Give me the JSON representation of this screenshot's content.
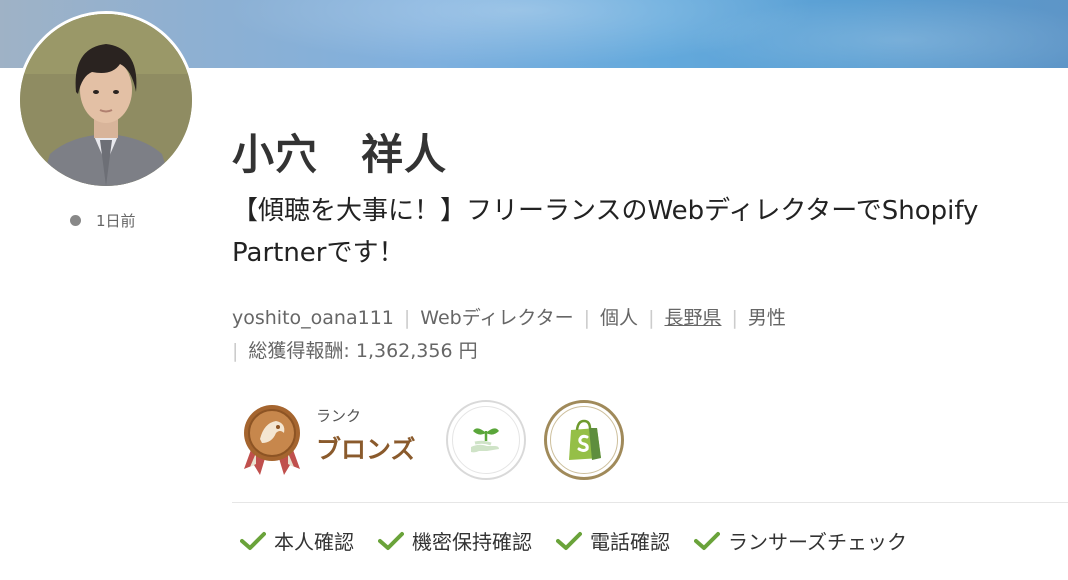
{
  "profile": {
    "name": "小穴　祥人",
    "catchphrase": "【傾聴を大事に！】フリーランスのWebディレクターでShopify Partnerです！",
    "last_login": "1日前",
    "username": "yoshito_oana111",
    "occupation": "Webディレクター",
    "type": "個人",
    "location": "長野県",
    "gender": "男性",
    "total_earnings_label": "総獲得報酬:",
    "total_earnings_value": "1,362,356 円"
  },
  "rank": {
    "label": "ランク",
    "value": "ブロンズ",
    "color": "#8a5a2c"
  },
  "badges": [
    {
      "icon": "sprout-hand-icon"
    },
    {
      "icon": "shopify-bag-icon"
    }
  ],
  "verifications": [
    {
      "label": "本人確認"
    },
    {
      "label": "機密保持確認"
    },
    {
      "label": "電話確認"
    },
    {
      "label": "ランサーズチェック"
    }
  ],
  "colors": {
    "check": "#6aa33a",
    "banner": "#63a9dc",
    "status_dot": "#888888"
  }
}
